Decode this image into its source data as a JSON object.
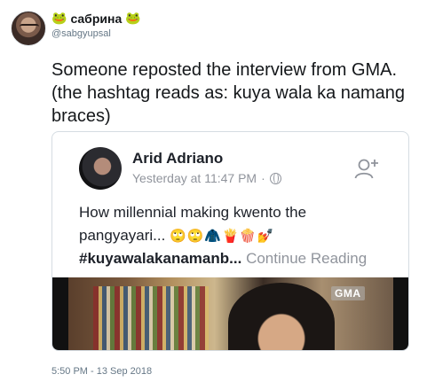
{
  "author": {
    "display_name": "сабрина",
    "handle": "@sabgyupsal",
    "name_emoji_left": "🐸",
    "name_emoji_right": "🐸"
  },
  "tweet": {
    "text": "Someone reposted the interview from GMA. (the hashtag reads as: kuya wala ka namang braces)",
    "timestamp": "5:50 PM - 13 Sep 2018"
  },
  "embed": {
    "poster_name": "Arid Adriano",
    "post_time": "Yesterday at 11:47 PM",
    "separator": "·",
    "body_text": "How millennial making kwento the pangyayari...",
    "emojis": "🙄🙄🧥🍟🍿💅",
    "hashtag": "#kuyawalakanamanb...",
    "continue_label": "Continue Reading",
    "video_watermark": "GMA"
  },
  "icons": {
    "globe": "globe-icon",
    "add_friend": "add-friend-icon",
    "frog": "frog-icon"
  },
  "colors": {
    "text_primary": "#14171a",
    "text_secondary": "#657786",
    "fb_text": "#1d2129",
    "fb_meta": "#90949c",
    "border": "#d5dce2"
  }
}
